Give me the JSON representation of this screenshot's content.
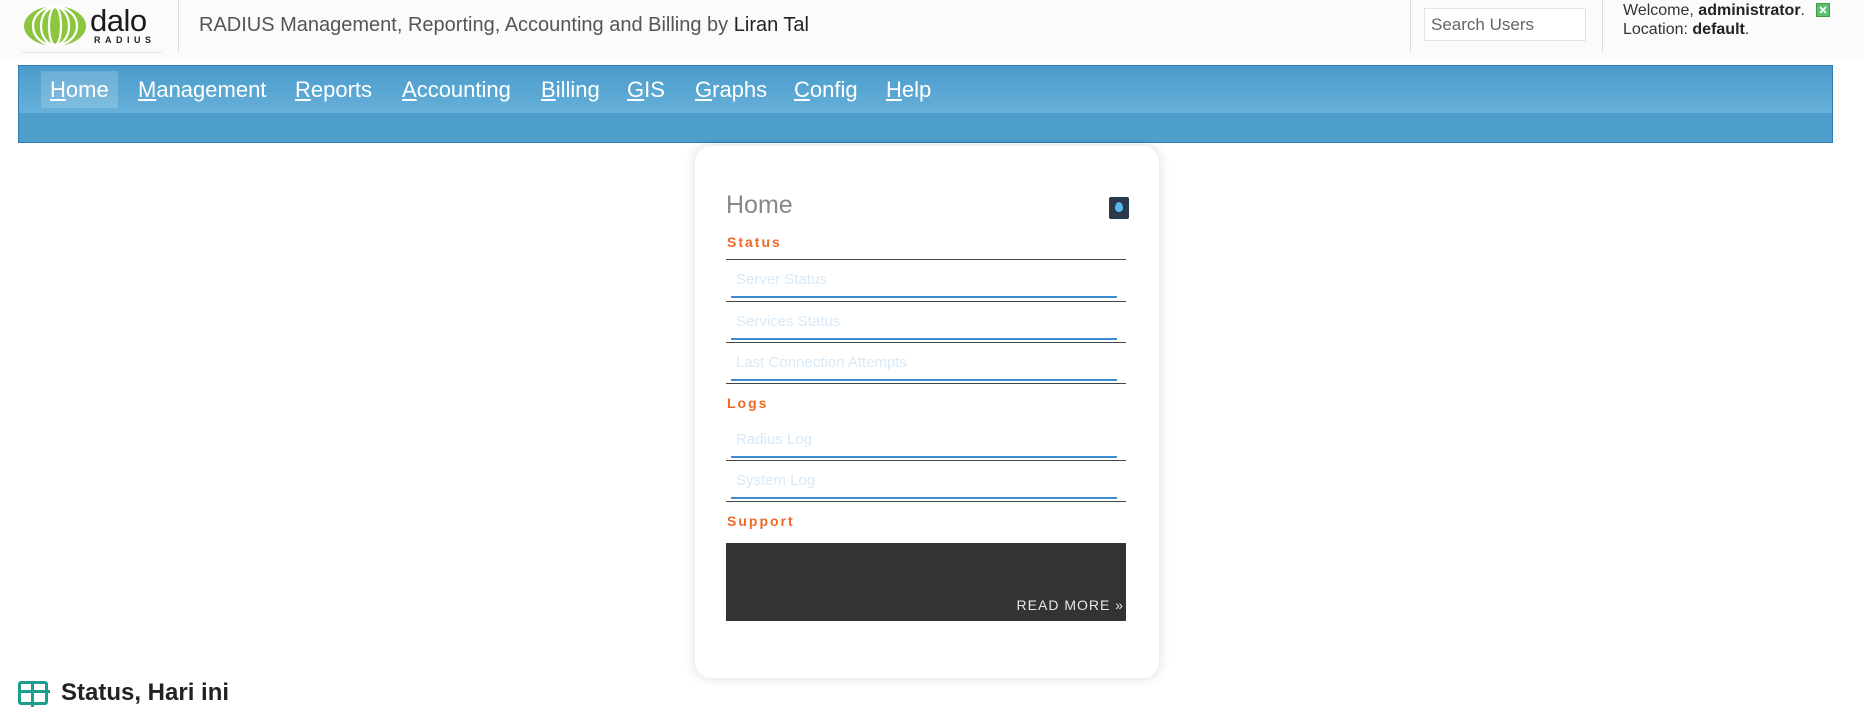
{
  "header": {
    "logo_word": "dalo",
    "logo_sub": "RADIUS",
    "tagline": "RADIUS Management, Reporting, Accounting and Billing by",
    "author": "Liran Tal",
    "search_placeholder": "Search Users",
    "welcome_prefix": "Welcome,",
    "username": "administrator",
    "location_prefix": "Location:",
    "location": "default"
  },
  "nav": {
    "items": [
      {
        "first": "H",
        "rest": "ome"
      },
      {
        "first": "M",
        "rest": "anagement"
      },
      {
        "first": "R",
        "rest": "eports"
      },
      {
        "first": "A",
        "rest": "ccounting"
      },
      {
        "first": "B",
        "rest": "illing"
      },
      {
        "first": "G",
        "rest": "IS"
      },
      {
        "first": "G",
        "rest": "raphs"
      },
      {
        "first": "C",
        "rest": "onfig"
      },
      {
        "first": "H",
        "rest": "elp"
      }
    ]
  },
  "menu": {
    "title": "Home",
    "sections": {
      "status": "Status",
      "logs": "Logs",
      "support": "Support"
    },
    "links": {
      "server_status": "Server Status",
      "services_status": "Services Status",
      "last_connection_attempts": "Last Connection Attempts",
      "radius_log": "Radius Log",
      "system_log": "System Log"
    },
    "read_more": "READ MORE »"
  },
  "main": {
    "status_title": "Status, Hari ini"
  },
  "colors": {
    "nav_blue": "#4f9fcd",
    "section_orange": "#ea6a28",
    "link_underline": "#3f8ad0",
    "logo_green": "#8cc63f",
    "icon_teal": "#1d9d8c"
  }
}
